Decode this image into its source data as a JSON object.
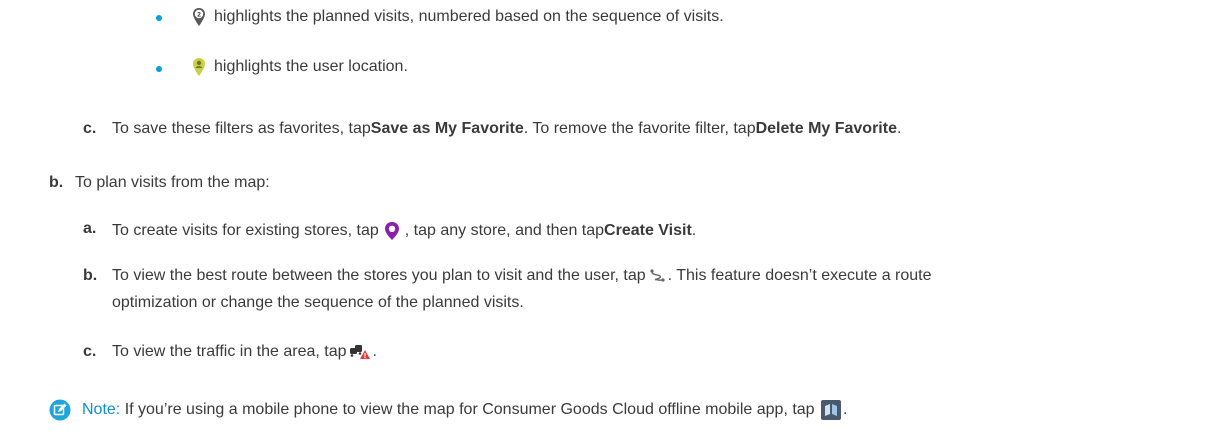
{
  "bullets": [
    {
      "text": "highlights the planned visits, numbered based on the sequence of visits.",
      "icon": "numbered-pin-icon"
    },
    {
      "text": "highlights the user location.",
      "icon": "user-location-pin-icon"
    }
  ],
  "favorites": {
    "marker": "c.",
    "t1": "To save these filters as favorites, tap ",
    "b1": "Save as My Favorite",
    "t2": ". To remove the favorite filter, tap ",
    "b2": "Delete My Favorite",
    "t3": "."
  },
  "plan": {
    "marker": "b.",
    "text": "To plan visits from the map:"
  },
  "steps": [
    {
      "marker": "a.",
      "t1": "To create visits for existing stores, tap ",
      "t2": ", tap any store, and then tap ",
      "b1": "Create Visit",
      "t3": ".",
      "icon": "location-pin-icon"
    },
    {
      "marker": "b.",
      "t1": "To view the best route between the stores you plan to visit and the user, tap ",
      "t2": ". This feature doesn’t execute a route",
      "line2": "optimization or change the sequence of the planned visits.",
      "icon": "route-icon"
    },
    {
      "marker": "c.",
      "t1": "To view the traffic in the area, tap ",
      "t2": ".",
      "icon": "traffic-icon"
    }
  ],
  "note": {
    "label": "Note:",
    "text": " If you’re using a mobile phone to view the map for Consumer Goods Cloud offline mobile app, tap ",
    "end": ".",
    "icon": "map-toggle-icon"
  },
  "colors": {
    "accent": "#00a1e0",
    "pin_purple": "#8b1fa9",
    "user_pin": "#c8d14a",
    "note_blue": "#0d8fce"
  }
}
